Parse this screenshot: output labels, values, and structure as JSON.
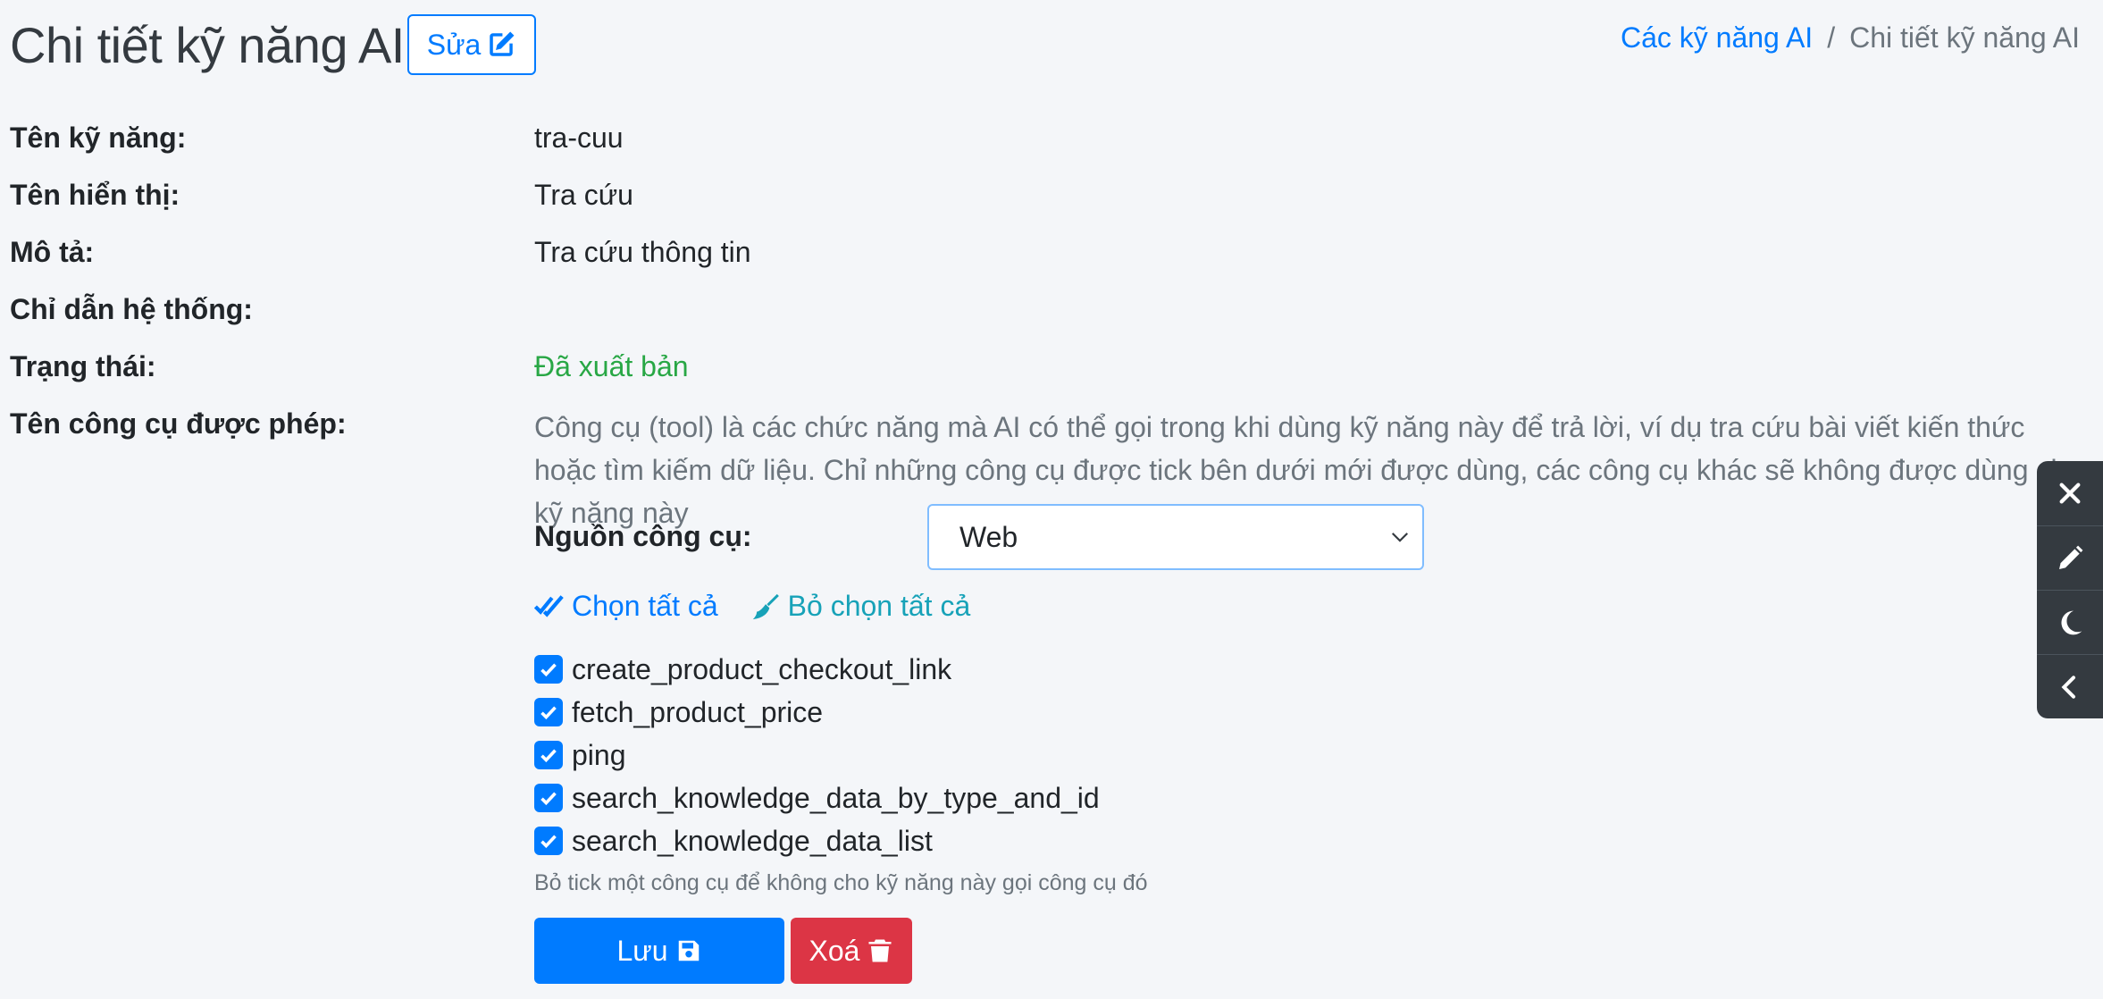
{
  "header": {
    "title": "Chi tiết kỹ năng AI",
    "edit_label": "Sửa"
  },
  "breadcrumb": {
    "parent": "Các kỹ năng AI",
    "separator": "/",
    "current": "Chi tiết kỹ năng AI"
  },
  "fields": {
    "name_label": "Tên kỹ năng:",
    "name_value": "tra-cuu",
    "display_label": "Tên hiển thị:",
    "display_value": "Tra cứu",
    "desc_label": "Mô tả:",
    "desc_value": "Tra cứu thông tin",
    "system_label": "Chỉ dẫn hệ thống:",
    "system_value": "",
    "status_label": "Trạng thái:",
    "status_value": "Đã xuất bản",
    "tools_label": "Tên công cụ được phép:"
  },
  "tools": {
    "description": "Công cụ (tool) là các chức năng mà AI có thể gọi trong khi dùng kỹ năng này để trả lời, ví dụ tra cứu bài viết kiến thức hoặc tìm kiếm dữ liệu. Chỉ những công cụ được tick bên dưới mới được dùng, các công cụ khác sẽ không được dùng cho kỹ năng này",
    "source_label": "Nguồn công cụ:",
    "source_value": "Web",
    "select_all": "Chọn tất cả",
    "deselect_all": "Bỏ chọn tất cả",
    "items": [
      {
        "name": "create_product_checkout_link",
        "checked": true
      },
      {
        "name": "fetch_product_price",
        "checked": true
      },
      {
        "name": "ping",
        "checked": true
      },
      {
        "name": "search_knowledge_data_by_type_and_id",
        "checked": true
      },
      {
        "name": "search_knowledge_data_list",
        "checked": true
      }
    ],
    "hint": "Bỏ tick một công cụ để không cho kỹ năng này gọi công cụ đó"
  },
  "actions": {
    "save_label": "Lưu",
    "delete_label": "Xoá"
  },
  "side_panel": {
    "icons": [
      "close-icon",
      "pencil-icon",
      "moon-icon",
      "chevron-left-icon"
    ]
  },
  "colors": {
    "primary": "#007bff",
    "success": "#28a745",
    "danger": "#dc3545",
    "info": "#17a2b8",
    "panel": "#343a40"
  }
}
